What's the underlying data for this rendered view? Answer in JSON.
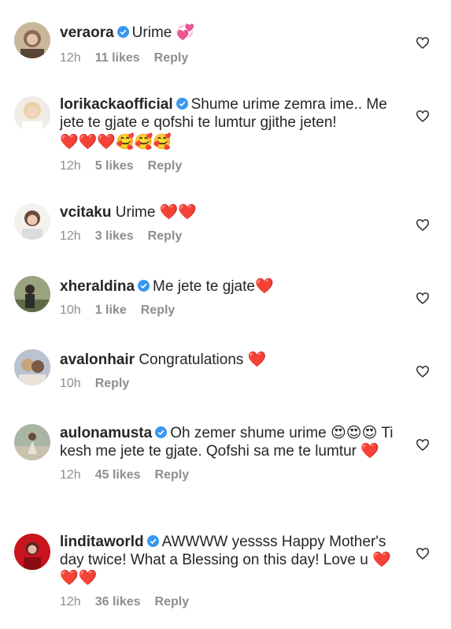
{
  "colors": {
    "username": "#262626",
    "meta": "#8e8e8e",
    "verified": "#3897f0",
    "heart_emoji": "#e0202b"
  },
  "comments": [
    {
      "username": "veraora",
      "verified": true,
      "text": "Urime",
      "emoji": "💞",
      "time": "12h",
      "likes": "11 likes",
      "reply": "Reply"
    },
    {
      "username": "lorikackaofficial",
      "verified": true,
      "text": "Shume urime zemra ime.. Me jete te gjate e qofshi te lumtur gjithe jeten!",
      "emoji": "❤️❤️❤️🥰🥰🥰",
      "time": "12h",
      "likes": "5 likes",
      "reply": "Reply"
    },
    {
      "username": "vcitaku",
      "verified": false,
      "text": "Urime",
      "emoji": "❤️❤️",
      "time": "12h",
      "likes": "3 likes",
      "reply": "Reply"
    },
    {
      "username": "xheraldina",
      "verified": true,
      "text": "Me jete te gjate",
      "emoji": "❤️",
      "time": "10h",
      "likes": "1 like",
      "reply": "Reply"
    },
    {
      "username": "avalonhair",
      "verified": false,
      "text": "Congratulations",
      "emoji": "❤️",
      "time": "10h",
      "likes": "",
      "reply": "Reply"
    },
    {
      "username": "aulonamusta",
      "verified": true,
      "text": "Oh zemer shume urime 😍😍😍 Ti kesh me jete te gjate. Qofshi sa me te lumtur",
      "emoji": "❤️",
      "time": "12h",
      "likes": "45 likes",
      "reply": "Reply"
    },
    {
      "username": "linditaworld",
      "verified": true,
      "text": "AWWWW yessss Happy Mother's day twice! What a Blessing on this day! Love u",
      "emoji": "❤️❤️❤️",
      "time": "12h",
      "likes": "36 likes",
      "reply": "Reply"
    }
  ]
}
